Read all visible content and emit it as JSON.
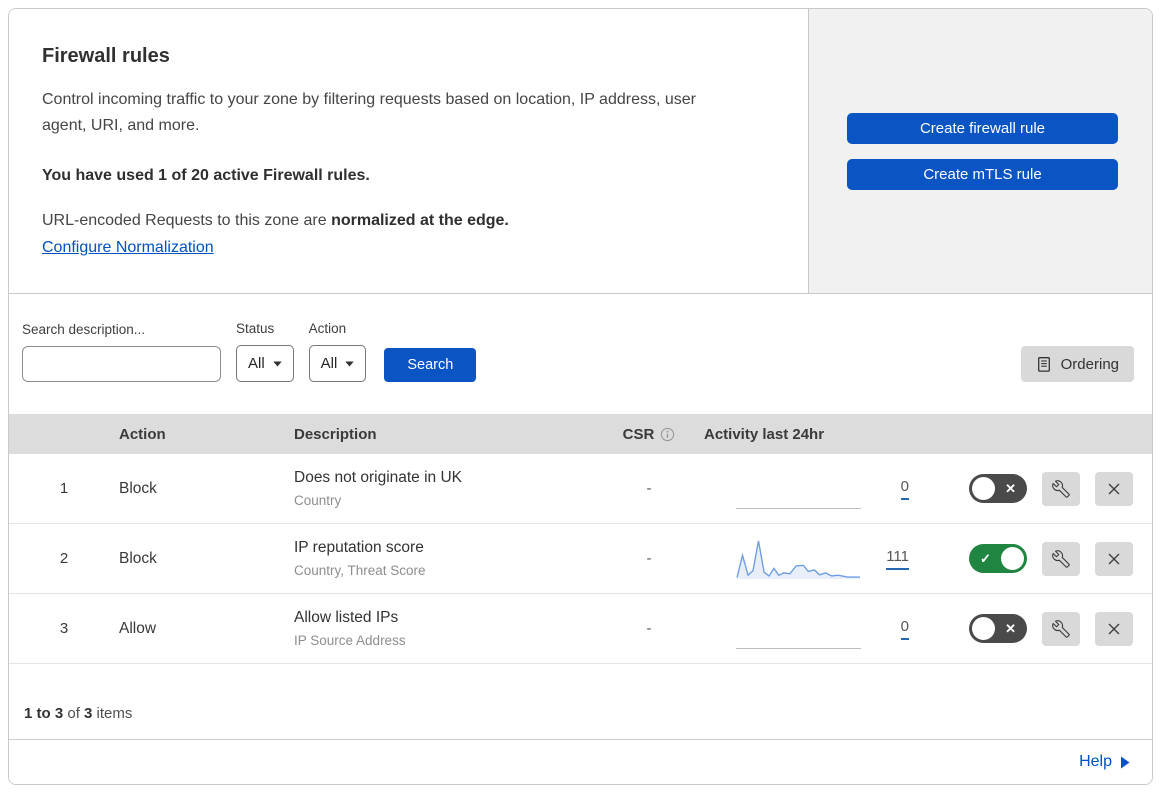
{
  "header": {
    "title": "Firewall rules",
    "description": "Control incoming traffic to your zone by filtering requests based on location, IP address, user agent, URI, and more.",
    "usage_bold": "You have used 1 of 20 active Firewall rules.",
    "normalization_prefix": "URL-encoded Requests to this zone are ",
    "normalization_bold": "normalized at the edge.",
    "normalization_link": "Configure Normalization",
    "create_firewall_button": "Create firewall rule",
    "create_mtls_button": "Create mTLS rule"
  },
  "filters": {
    "search_label": "Search description...",
    "search_placeholder": "",
    "search_value": "",
    "status_label": "Status",
    "status_value": "All",
    "action_label": "Action",
    "action_value": "All",
    "search_button": "Search",
    "ordering_button": "Ordering"
  },
  "table": {
    "columns": {
      "action": "Action",
      "description": "Description",
      "csr": "CSR",
      "activity": "Activity last 24hr"
    },
    "rows": [
      {
        "num": "1",
        "action": "Block",
        "description": "Does not originate in UK",
        "fields": "Country",
        "csr": "-",
        "count": "0",
        "enabled": false,
        "spark": "flat"
      },
      {
        "num": "2",
        "action": "Block",
        "description": "IP reputation score",
        "fields": "Country, Threat Score",
        "csr": "-",
        "count": "111",
        "enabled": true,
        "spark": "series"
      },
      {
        "num": "3",
        "action": "Allow",
        "description": "Allow listed IPs",
        "fields": "IP Source Address",
        "csr": "-",
        "count": "0",
        "enabled": false,
        "spark": "flat"
      }
    ],
    "sparkline_points": [
      [
        0,
        0.04
      ],
      [
        0.045,
        0.62
      ],
      [
        0.09,
        0.1
      ],
      [
        0.13,
        0.22
      ],
      [
        0.175,
        1.0
      ],
      [
        0.22,
        0.18
      ],
      [
        0.26,
        0.08
      ],
      [
        0.3,
        0.28
      ],
      [
        0.34,
        0.1
      ],
      [
        0.38,
        0.16
      ],
      [
        0.43,
        0.14
      ],
      [
        0.48,
        0.34
      ],
      [
        0.54,
        0.36
      ],
      [
        0.58,
        0.2
      ],
      [
        0.63,
        0.24
      ],
      [
        0.67,
        0.11
      ],
      [
        0.72,
        0.16
      ],
      [
        0.77,
        0.08
      ],
      [
        0.82,
        0.1
      ],
      [
        0.9,
        0.05
      ],
      [
        1,
        0.05
      ]
    ]
  },
  "footer": {
    "range_bold": "1 to 3",
    "of_text": " of ",
    "total_bold": "3",
    "items_text": " items",
    "help_label": "Help"
  },
  "colors": {
    "accent_blue": "#0b54c4",
    "link_blue": "#0051c3",
    "toggle_on_green": "#1f8540",
    "toggle_off_gray": "#4a4a4a",
    "sparkline_blue": "#6f9ee8",
    "table_header_gray": "#dcdcdc",
    "panel_gray": "#f1f1f1"
  }
}
